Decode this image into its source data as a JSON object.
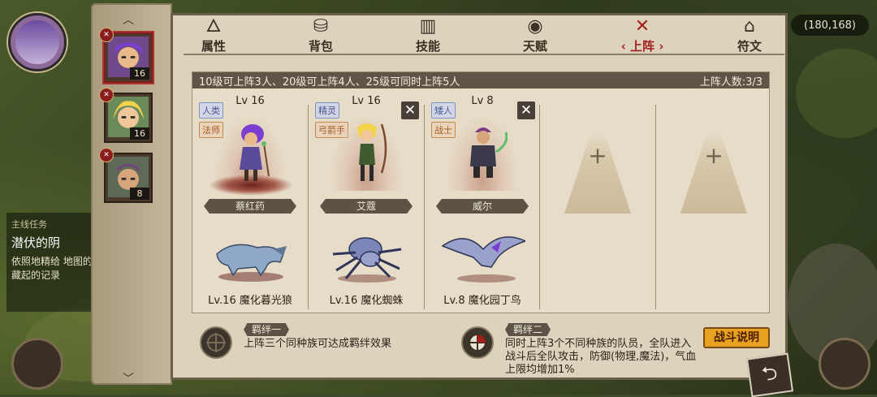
{
  "hud": {
    "coords": "(180,168)",
    "quest_type": "主线任务",
    "quest_title": "潜伏的阴",
    "quest_desc": "依照地精给 地图的 藏起的记录"
  },
  "roster": [
    {
      "level": "16",
      "badge": "✕"
    },
    {
      "level": "16",
      "badge": "✕"
    },
    {
      "level": "8",
      "badge": "✕"
    }
  ],
  "tabs": [
    {
      "label": "属性",
      "icon": "flame-icon"
    },
    {
      "label": "背包",
      "icon": "backpack-icon"
    },
    {
      "label": "技能",
      "icon": "book-icon"
    },
    {
      "label": "天赋",
      "icon": "eye-icon"
    },
    {
      "label": "上阵",
      "icon": "crossed-swords-icon"
    },
    {
      "label": "符文",
      "icon": "rune-icon"
    }
  ],
  "lineup": {
    "rule_text": "10级可上阵3人、20级可上阵4人、25级可同时上阵5人",
    "count_text": "上阵人数:3/3",
    "slots": [
      {
        "level": "Lv 16",
        "race": "人类",
        "class": "法师",
        "name": "蔡红药",
        "pet": "Lv.16 魔化暮光狼",
        "removable": false
      },
      {
        "level": "Lv 16",
        "race": "精灵",
        "class": "弓箭手",
        "name": "艾蔻",
        "pet": "Lv.16 魔化蜘蛛",
        "removable": true
      },
      {
        "level": "Lv 8",
        "race": "矮人",
        "class": "战士",
        "name": "威尔",
        "pet": "Lv.8 魔化园丁鸟",
        "removable": true
      }
    ],
    "empty_plus": "+",
    "remove_glyph": "✕"
  },
  "bonds": {
    "bond1_title": "羁绊一",
    "bond1_text": "上阵三个同种族可达成羁绊效果",
    "bond2_title": "羁绊二",
    "bond2_line1": "同时上阵3个不同种族的队员，全队进入",
    "bond2_line2": "战斗后全队攻击，防御(物理,魔法)，气血",
    "bond2_line3": "上限均增加1%"
  },
  "buttons": {
    "battle_info": "战斗说明",
    "back": "⮌"
  },
  "arrows": {
    "up": "︿",
    "down": "﹀"
  },
  "colors": {
    "panel": "#ddd3bd",
    "active_tab": "#a31f1f",
    "battle_button": "#e8a21f"
  }
}
